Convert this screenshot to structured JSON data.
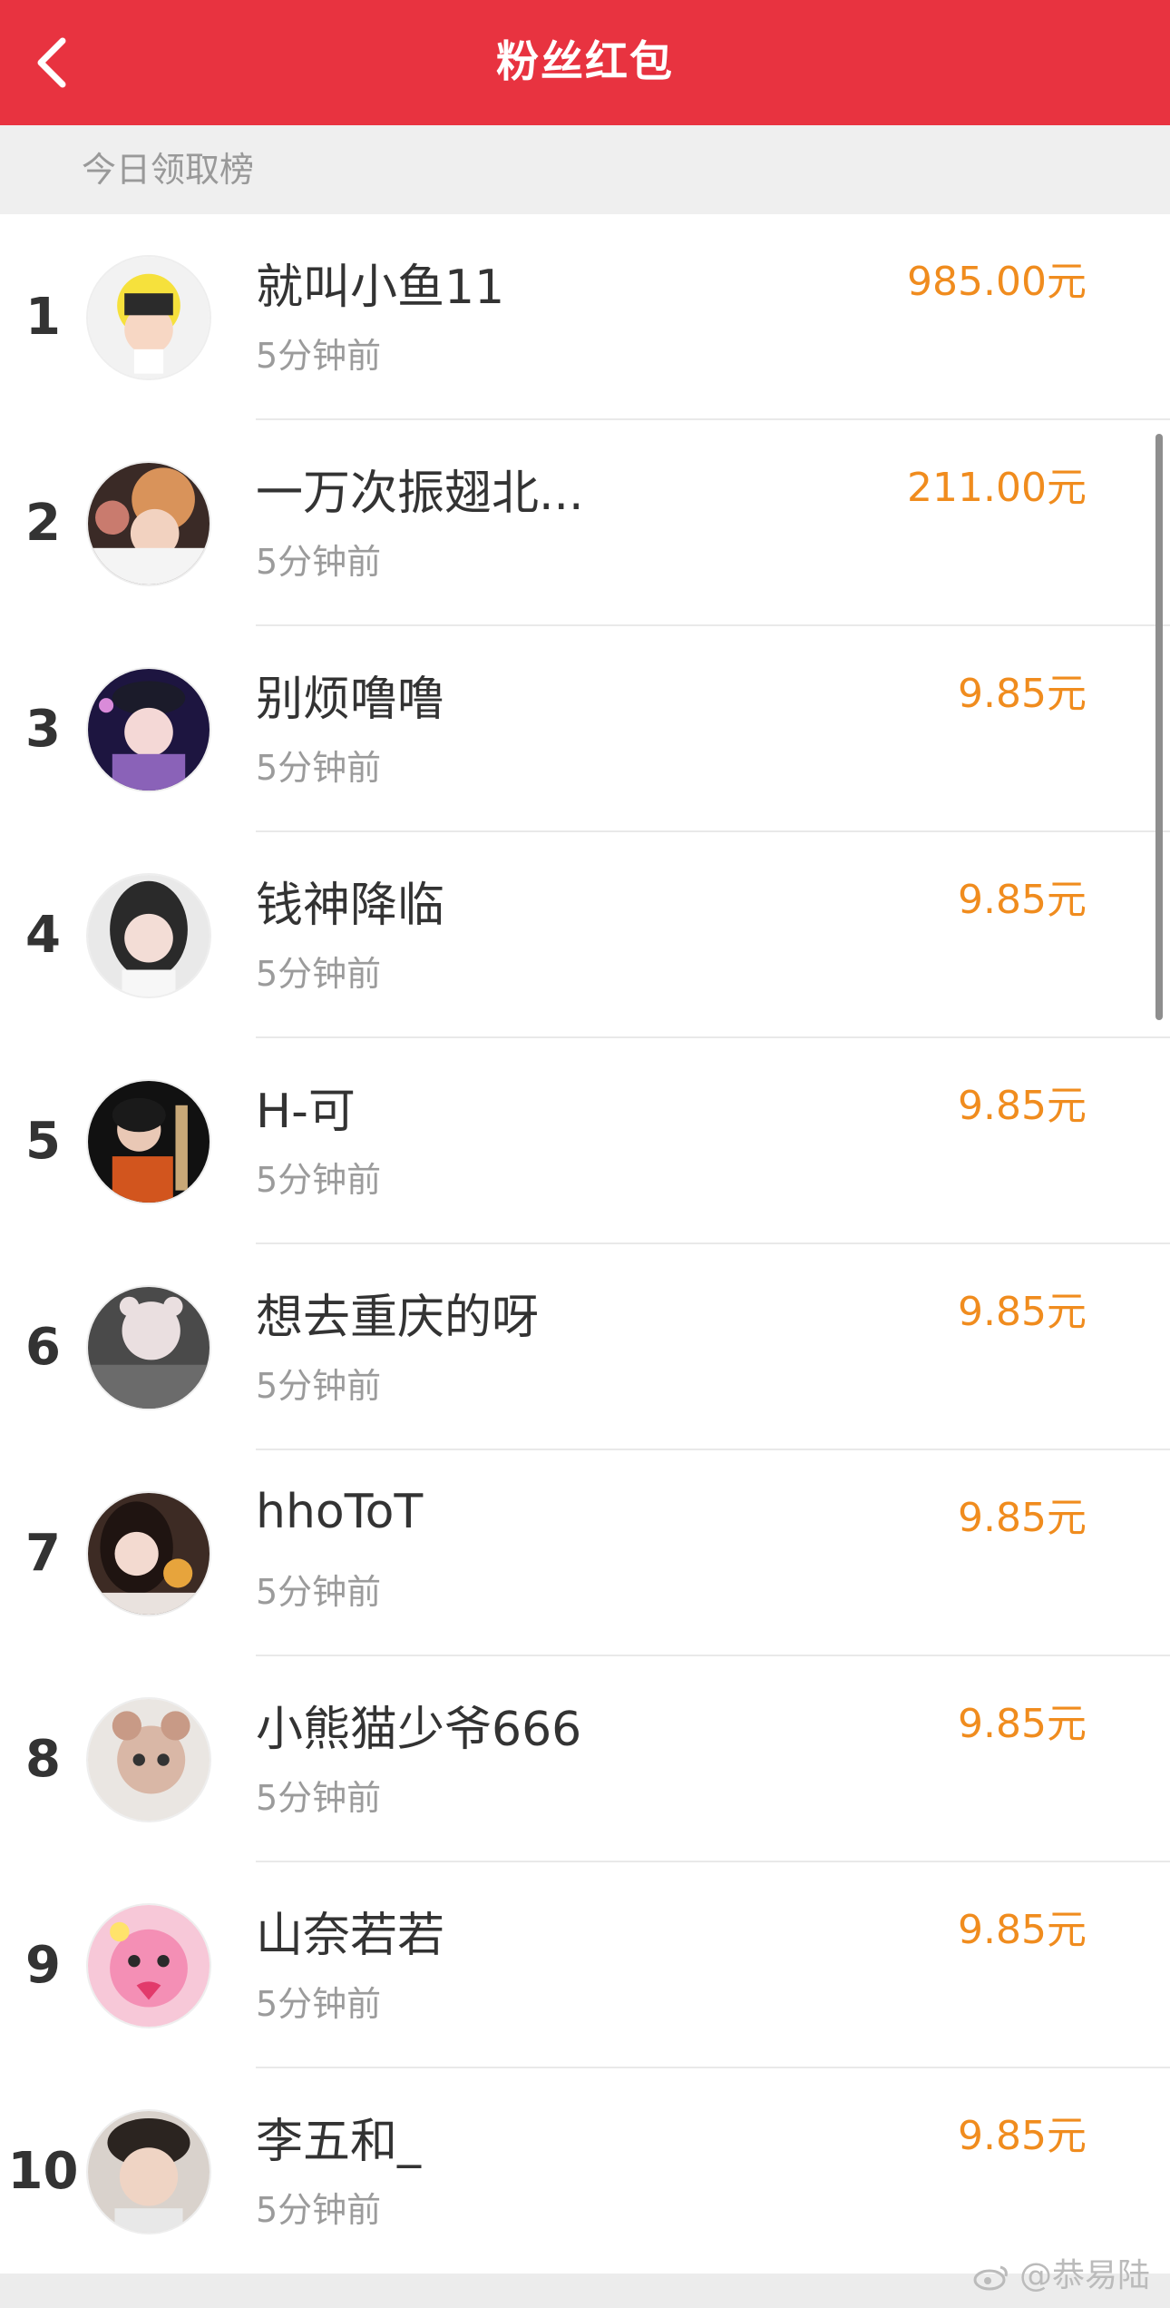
{
  "header": {
    "title": "粉丝红包"
  },
  "subheader": {
    "label": "今日领取榜"
  },
  "rows": [
    {
      "rank": "1",
      "name": "就叫小鱼11",
      "time": "5分钟前",
      "amount": "985.00元"
    },
    {
      "rank": "2",
      "name": "一万次振翅北...",
      "time": "5分钟前",
      "amount": "211.00元"
    },
    {
      "rank": "3",
      "name": "别烦噜噜",
      "time": "5分钟前",
      "amount": "9.85元"
    },
    {
      "rank": "4",
      "name": "钱神降临",
      "time": "5分钟前",
      "amount": "9.85元"
    },
    {
      "rank": "5",
      "name": "H-可",
      "time": "5分钟前",
      "amount": "9.85元"
    },
    {
      "rank": "6",
      "name": "想去重庆的呀",
      "time": "5分钟前",
      "amount": "9.85元"
    },
    {
      "rank": "7",
      "name": "hhoToT",
      "time": "5分钟前",
      "amount": "9.85元"
    },
    {
      "rank": "8",
      "name": "小熊猫少爷666",
      "time": "5分钟前",
      "amount": "9.85元"
    },
    {
      "rank": "9",
      "name": "山奈若若",
      "time": "5分钟前",
      "amount": "9.85元"
    },
    {
      "rank": "10",
      "name": "李五和_",
      "time": "5分钟前",
      "amount": "9.85元"
    }
  ],
  "watermark": "@恭易陆",
  "colors": {
    "header_bg": "#e83340",
    "amount": "#f08c1e",
    "subheader_bg": "#efefef"
  },
  "icons": {
    "back": "chevron-left-icon",
    "watermark": "weibo-icon"
  }
}
